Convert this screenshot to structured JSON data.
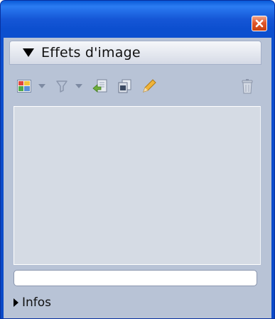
{
  "window": {
    "close_icon": "close-x-icon"
  },
  "panel": {
    "title": "Effets d'image",
    "collapse_icon": "triangle-down-icon"
  },
  "toolbar": {
    "items": [
      {
        "name": "color-grid-icon"
      },
      {
        "name": "dropdown-arrow-icon"
      },
      {
        "name": "filter-icon"
      },
      {
        "name": "dropdown-arrow-icon"
      },
      {
        "name": "import-icon"
      },
      {
        "name": "duplicate-icon"
      },
      {
        "name": "pencil-icon"
      },
      {
        "name": "trash-icon"
      }
    ]
  },
  "text_field": {
    "value": ""
  },
  "infos": {
    "label": "Infos",
    "expand_icon": "triangle-right-icon"
  },
  "colors": {
    "titlebar": "#0a5ad8",
    "client": "#b8c3d6",
    "preview": "#d5dbe4",
    "close_button": "#e2582c"
  }
}
